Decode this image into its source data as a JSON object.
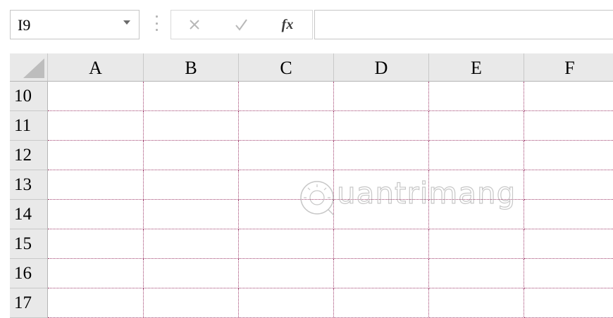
{
  "formula_bar": {
    "name_box_value": "I9",
    "fx_label": "fx",
    "formula_value": ""
  },
  "columns": [
    "A",
    "B",
    "C",
    "D",
    "E",
    "F"
  ],
  "rows": [
    "10",
    "11",
    "12",
    "13",
    "14",
    "15",
    "16",
    "17"
  ],
  "watermark": "uantrimang",
  "colors": {
    "gridline": "#a0406e",
    "header_bg": "#e9e9e9"
  }
}
